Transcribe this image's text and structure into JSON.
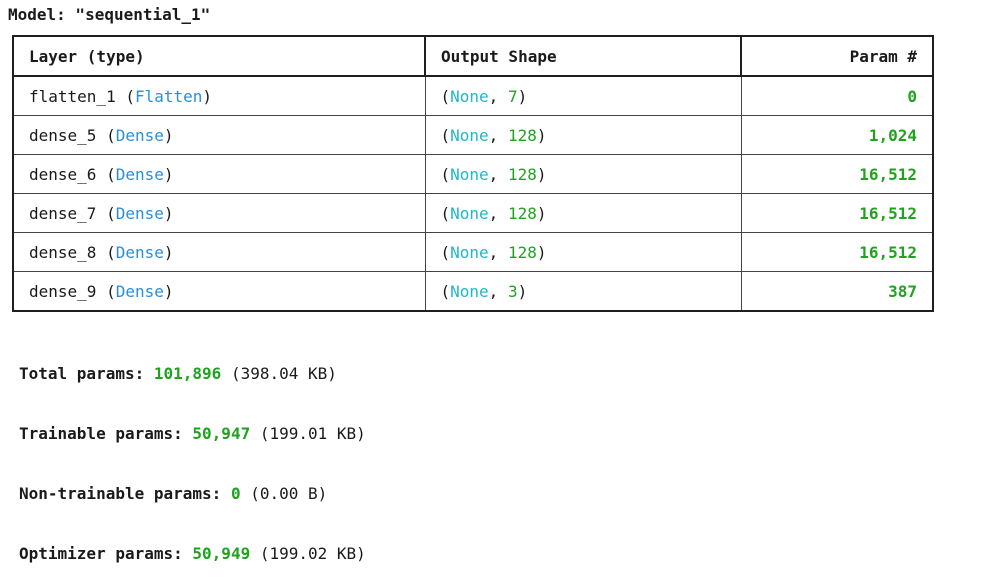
{
  "model_title": "Model: \"sequential_1\"",
  "table": {
    "headers": {
      "layer": "Layer (type)",
      "output_shape": "Output Shape",
      "params": "Param #"
    },
    "rows": [
      {
        "name": "flatten_1",
        "type": "Flatten",
        "shape_none": "None",
        "shape_dim": "7",
        "params": "0"
      },
      {
        "name": "dense_5",
        "type": "Dense",
        "shape_none": "None",
        "shape_dim": "128",
        "params": "1,024"
      },
      {
        "name": "dense_6",
        "type": "Dense",
        "shape_none": "None",
        "shape_dim": "128",
        "params": "16,512"
      },
      {
        "name": "dense_7",
        "type": "Dense",
        "shape_none": "None",
        "shape_dim": "128",
        "params": "16,512"
      },
      {
        "name": "dense_8",
        "type": "Dense",
        "shape_none": "None",
        "shape_dim": "128",
        "params": "16,512"
      },
      {
        "name": "dense_9",
        "type": "Dense",
        "shape_none": "None",
        "shape_dim": "3",
        "params": "387"
      }
    ]
  },
  "totals": {
    "total": {
      "label": "Total params:",
      "value": "101,896",
      "size": "(398.04 KB)"
    },
    "trainable": {
      "label": "Trainable params:",
      "value": "50,947",
      "size": "(199.01 KB)"
    },
    "non_trainable": {
      "label": "Non-trainable params:",
      "value": "0",
      "size": "(0.00 B)"
    },
    "optimizer": {
      "label": "Optimizer params:",
      "value": "50,949",
      "size": "(199.02 KB)"
    }
  },
  "colors": {
    "class_name": "#2a8fd8",
    "none_keyword": "#1fb8c8",
    "number": "#1fa31f"
  }
}
